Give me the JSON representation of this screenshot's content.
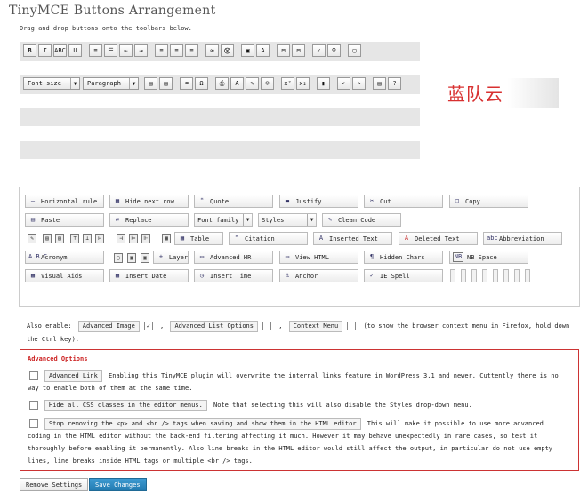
{
  "page": {
    "title": "TinyMCE Buttons Arrangement",
    "instructions": "Drag and drop buttons onto the toolbars below."
  },
  "toolbar1": {
    "buttons": [
      {
        "name": "bold-button",
        "glyph": "B"
      },
      {
        "name": "italic-button",
        "glyph": "I"
      },
      {
        "name": "strikethrough-button",
        "glyph": "ABC"
      },
      {
        "name": "underline-button",
        "glyph": "U"
      },
      {
        "name": "bullet-list-button",
        "glyph": "≡"
      },
      {
        "name": "numbered-list-button",
        "glyph": "☰"
      },
      {
        "name": "outdent-button",
        "glyph": "⇤"
      },
      {
        "name": "indent-button",
        "glyph": "⇥"
      },
      {
        "name": "align-left-button",
        "glyph": "≡"
      },
      {
        "name": "align-center-button",
        "glyph": "≡"
      },
      {
        "name": "align-right-button",
        "glyph": "≡"
      },
      {
        "name": "link-button",
        "glyph": "∞"
      },
      {
        "name": "unlink-button",
        "glyph": "⨂"
      },
      {
        "name": "insert-image-button",
        "glyph": "▣"
      },
      {
        "name": "help-button",
        "glyph": "A"
      },
      {
        "name": "page-break-button",
        "glyph": "⊟"
      },
      {
        "name": "more-tag-button",
        "glyph": "⊟"
      },
      {
        "name": "spellcheck-button",
        "glyph": "✓"
      },
      {
        "name": "find-button",
        "glyph": "⚲"
      },
      {
        "name": "fullscreen-button",
        "glyph": "▢"
      }
    ]
  },
  "toolbar2": {
    "font_size": "Font size",
    "paragraph": "Paragraph",
    "buttons": [
      {
        "name": "paste-text-button",
        "glyph": "▤"
      },
      {
        "name": "paste-word-button",
        "glyph": "▤"
      },
      {
        "name": "remove-format-button",
        "glyph": "⌫"
      },
      {
        "name": "special-char-button",
        "glyph": "Ω"
      },
      {
        "name": "print-button",
        "glyph": "⎙"
      },
      {
        "name": "text-color-button",
        "glyph": "A"
      },
      {
        "name": "highlight-button",
        "glyph": "✎"
      },
      {
        "name": "emoticon-button",
        "glyph": "☺"
      },
      {
        "name": "superscript-button",
        "glyph": "x²"
      },
      {
        "name": "subscript-button",
        "glyph": "x₂"
      },
      {
        "name": "media-button",
        "glyph": "▮"
      },
      {
        "name": "undo-button",
        "glyph": "↶"
      },
      {
        "name": "redo-button",
        "glyph": "↷"
      },
      {
        "name": "paste-button",
        "glyph": "▤"
      },
      {
        "name": "help-circle-button",
        "glyph": "?"
      }
    ]
  },
  "brand": {
    "text": "蓝队云"
  },
  "pool": {
    "r1": [
      "Horizontal rule",
      "Hide next row",
      "Quote",
      "Justify",
      "Cut",
      "Copy"
    ],
    "r2": [
      "Paste",
      "Replace",
      "Font family",
      "Styles",
      "Clean Code"
    ],
    "r3": [
      "Table",
      "Citation",
      "Inserted Text",
      "Deleted Text",
      "Abbreviation"
    ],
    "r4": [
      "Acronym",
      "Layer",
      "Advanced HR",
      "View HTML",
      "Hidden Chars",
      "NB Space"
    ],
    "r5": [
      "Visual Aids",
      "Insert Date",
      "Insert Time",
      "Anchor",
      "IE Spell"
    ]
  },
  "also_enable": {
    "label": "Also enable:",
    "advanced_image": "Advanced Image",
    "advanced_list": "Advanced List Options",
    "context_menu": "Context Menu",
    "note": "(to show the browser context menu in Firefox, hold down the Ctrl key)."
  },
  "advanced": {
    "title": "Advanced Options",
    "link_label": "Advanced Link",
    "link_desc": "Enabling this TinyMCE plugin will overwrite the internal links feature in WordPress 3.1 and newer. Cuttently there is no way to enable both of them at the same time.",
    "css_label": "Hide all CSS classes in the editor menus.",
    "css_desc": "Note that selecting this will also disable the Styles drop-down menu.",
    "p_label": "Stop removing the <p> and <br /> tags when saving and show them in the HTML editor",
    "p_desc": "This will make it possible to use more advanced coding in the HTML editor without the back-end filtering affecting it much. However it may behave unexpectedly in rare cases, so test it thoroughly before enabling it permanently. Also line breaks in the HTML editor would still affect the output, in particular do not use empty lines, line breaks inside HTML tags or multiple <br /> tags."
  },
  "buttons": {
    "remove": "Remove Settings",
    "save": "Save Changes"
  }
}
